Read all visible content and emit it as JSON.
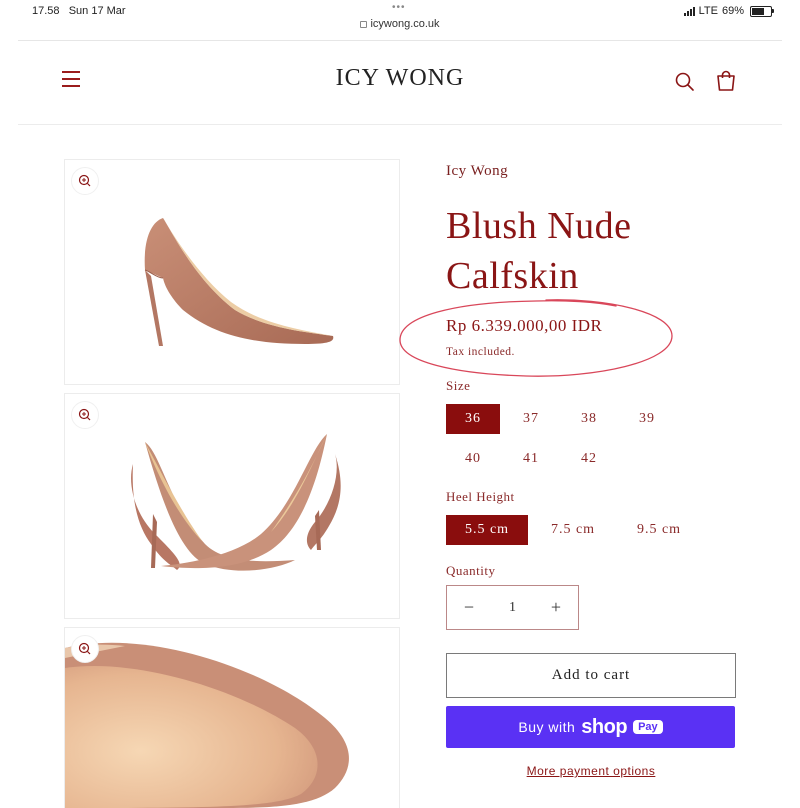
{
  "status": {
    "time": "17.58",
    "date": "Sun 17 Mar",
    "network": "LTE",
    "battery": "69%",
    "battery_level": 0.69
  },
  "browser": {
    "url": "icywong.co.uk"
  },
  "header": {
    "logo": "ICY WONG",
    "menu_icon": "menu-icon",
    "search_icon": "search-icon",
    "cart_icon": "cart-icon"
  },
  "gallery": {
    "zoom_icon": "zoom-in-icon",
    "images": [
      "pump-side-view",
      "pump-pair-view",
      "pump-toe-closeup"
    ]
  },
  "product": {
    "vendor": "Icy Wong",
    "title_line1": "Blush Nude",
    "title_line2": "Calfskin",
    "price": "Rp 6.339.000,00 IDR",
    "tax_note": "Tax included."
  },
  "size": {
    "label": "Size",
    "options": [
      "36",
      "37",
      "38",
      "39",
      "40",
      "41",
      "42"
    ],
    "selected": "36"
  },
  "heel": {
    "label": "Heel Height",
    "options": [
      "5.5 cm",
      "7.5 cm",
      "9.5 cm"
    ],
    "selected": "5.5 cm"
  },
  "quantity": {
    "label": "Quantity",
    "value": "1",
    "minus": "−",
    "plus": "+"
  },
  "actions": {
    "add_to_cart": "Add to cart",
    "buy_with": "Buy with",
    "shop": "shop",
    "pay": "Pay",
    "more_options": "More payment options"
  },
  "colors": {
    "accent": "#8a0d0d",
    "shop_pay": "#5a31f4",
    "annotation": "#d9475a"
  }
}
